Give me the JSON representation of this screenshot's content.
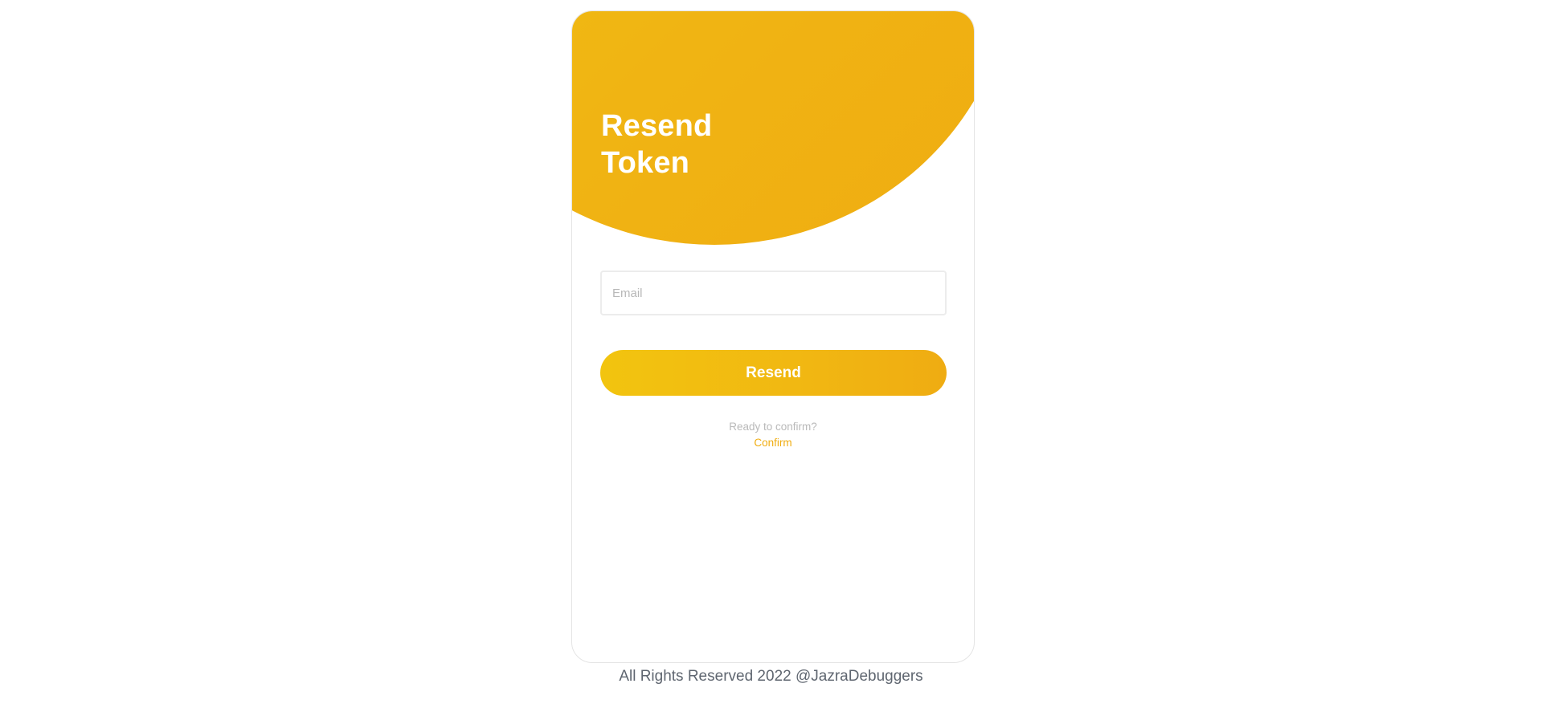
{
  "header": {
    "title_line1": "Resend",
    "title_line2": "Token"
  },
  "form": {
    "email_placeholder": "Email",
    "email_value": "",
    "resend_label": "Resend"
  },
  "confirm": {
    "prompt": "Ready to confirm?",
    "link_label": "Confirm"
  },
  "footer": {
    "text": "All Rights Reserved 2022 @JazraDebuggers"
  },
  "colors": {
    "accent": "#f1b712",
    "link": "#f0ad12",
    "muted_text": "#b9b9b9",
    "footer_text": "#5f6670"
  }
}
